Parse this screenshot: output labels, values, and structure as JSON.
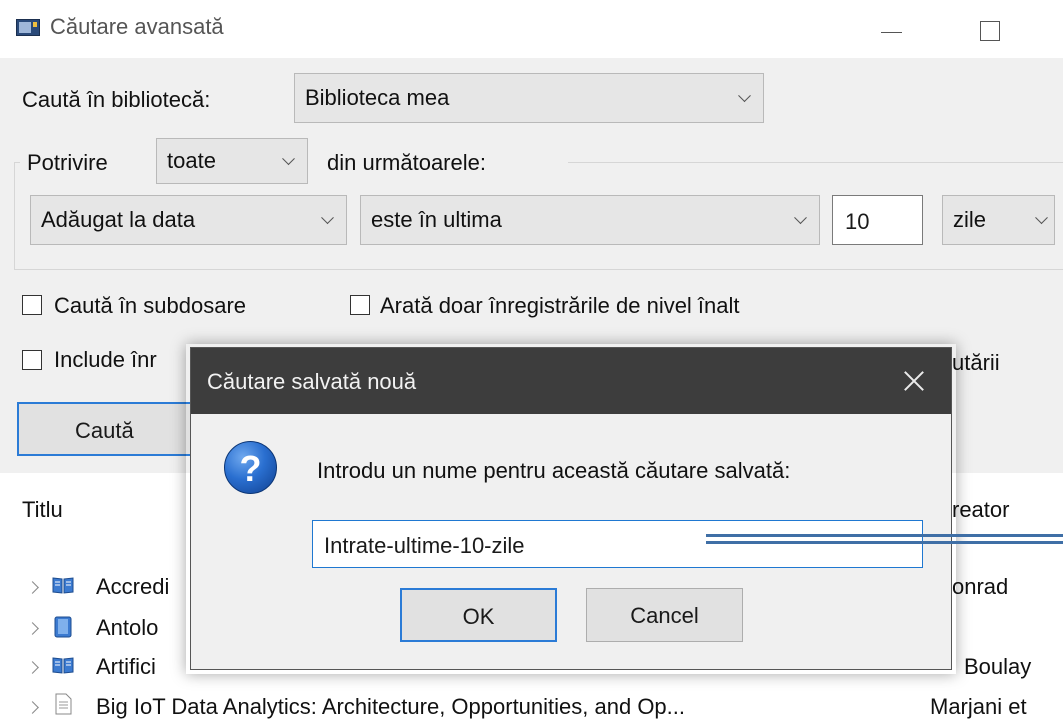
{
  "window": {
    "title": "Căutare avansată"
  },
  "search": {
    "library_label": "Caută în bibliotecă:",
    "library_value": "Biblioteca mea",
    "match_label": "Potrivire",
    "match_value": "toate",
    "match_suffix": "din următoarele:",
    "condition": {
      "field": "Adăugat la data",
      "operator": "este în ultima",
      "value": "10",
      "unit": "zile"
    },
    "options": {
      "subfolders": "Caută în subdosare",
      "top_level": "Arată doar înregistrările de nivel înalt",
      "include_partial": "Include înr",
      "include_suffix": "utării"
    },
    "search_button": "Caută"
  },
  "results": {
    "columns": {
      "title": "Titlu",
      "creator": "reator"
    },
    "rows": [
      {
        "icon": "book-icon",
        "title": "Accredi",
        "creator": "onrad"
      },
      {
        "icon": "book-section-icon",
        "title": "Antolo",
        "creator": ""
      },
      {
        "icon": "book-icon",
        "title": "Artifici",
        "creator": "Boulay"
      },
      {
        "icon": "document-icon",
        "title": "Big IoT Data Analytics: Architecture, Opportunities, and Op...",
        "creator": "Marjani et"
      }
    ]
  },
  "dialog": {
    "title": "Căutare salvată nouă",
    "prompt": "Introdu un nume pentru această căutare salvată:",
    "input_value": "Intrate-ultime-10-zile",
    "ok_label": "OK",
    "cancel_label": "Cancel"
  },
  "colors": {
    "accent": "#2b7bd6",
    "dialog_titlebar": "#3d3d3d",
    "panel_bg": "#f0f0f0"
  }
}
